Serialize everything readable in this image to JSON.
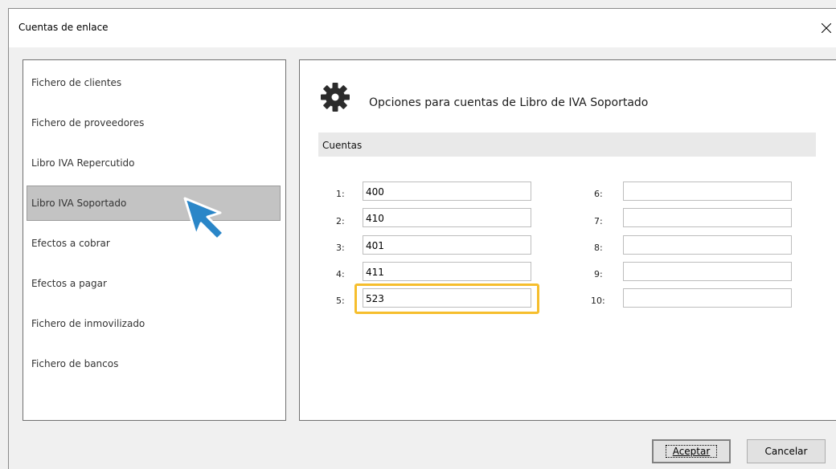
{
  "window": {
    "title": "Cuentas de enlace"
  },
  "nav": {
    "items": [
      {
        "label": "Fichero de clientes",
        "selected": false
      },
      {
        "label": "Fichero de proveedores",
        "selected": false
      },
      {
        "label": "Libro IVA Repercutido",
        "selected": false
      },
      {
        "label": "Libro IVA Soportado",
        "selected": true
      },
      {
        "label": "Efectos a cobrar",
        "selected": false
      },
      {
        "label": "Efectos a pagar",
        "selected": false
      },
      {
        "label": "Fichero de inmovilizado",
        "selected": false
      },
      {
        "label": "Fichero de bancos",
        "selected": false
      }
    ]
  },
  "main": {
    "heading": "Opciones para cuentas de Libro de IVA Soportado",
    "section_label": "Cuentas",
    "accounts_left": [
      {
        "label": "1:",
        "value": "400"
      },
      {
        "label": "2:",
        "value": "410"
      },
      {
        "label": "3:",
        "value": "401"
      },
      {
        "label": "4:",
        "value": "411"
      },
      {
        "label": "5:",
        "value": "523"
      }
    ],
    "accounts_right": [
      {
        "label": "6:",
        "value": ""
      },
      {
        "label": "7:",
        "value": ""
      },
      {
        "label": "8:",
        "value": ""
      },
      {
        "label": "9:",
        "value": ""
      },
      {
        "label": "10:",
        "value": ""
      }
    ]
  },
  "buttons": {
    "accept": "Aceptar",
    "cancel": "Cancelar"
  },
  "colors": {
    "highlight": "#f6be2d",
    "cursor": "#2a86c8",
    "selected_bg": "#c3c3c3"
  }
}
